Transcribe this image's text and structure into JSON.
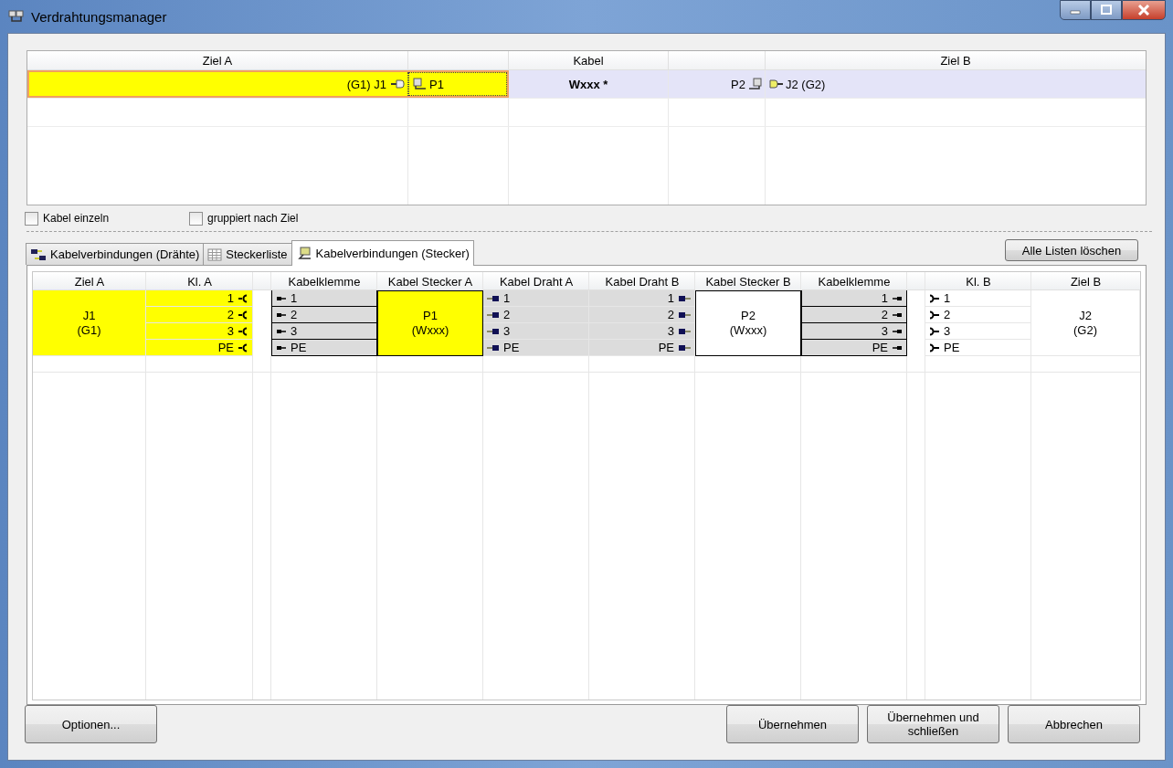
{
  "window": {
    "title": "Verdrahtungsmanager"
  },
  "cable_grid": {
    "columns": [
      "Ziel A",
      "Kabel",
      "Ziel B"
    ],
    "rows": [
      {
        "target_a": "(G1) J1",
        "plug_a": "P1",
        "cable": "Wxxx *",
        "plug_b": "P2",
        "target_b": "J2 (G2)",
        "selected": true,
        "highlighted": true
      }
    ]
  },
  "options": [
    {
      "label": "Kabel einzeln",
      "checked": false
    },
    {
      "label": "gruppiert nach Ziel",
      "checked": false
    }
  ],
  "tabs": [
    {
      "label": "Kabelverbindungen (Drähte)",
      "selected": false
    },
    {
      "label": "Steckerliste",
      "selected": false
    },
    {
      "label": "Kabelverbindungen (Stecker)",
      "selected": true
    }
  ],
  "clear_button": "Alle Listen löschen",
  "connection_table": {
    "columns": [
      "Ziel A",
      "Kl. A",
      "Kabelklemme",
      "Kabel Stecker A",
      "Kabel Draht A",
      "Kabel Draht B",
      "Kabel Stecker B",
      "Kabelklemme",
      "Kl. B",
      "Ziel B"
    ],
    "side_a": {
      "target": "J1",
      "group": "(G1)",
      "highlighted": true,
      "plug": "P1",
      "cable": "(Wxxx)",
      "plug_highlighted": true
    },
    "side_b": {
      "target": "J2",
      "group": "(G2)",
      "highlighted": false,
      "plug": "P2",
      "cable": "(Wxxx)",
      "plug_highlighted": false
    },
    "rows": [
      {
        "kl_a": "1",
        "klemme_a": "1",
        "draht_a": "1",
        "draht_b": "1",
        "klemme_b": "1",
        "kl_b": "1"
      },
      {
        "kl_a": "2",
        "klemme_a": "2",
        "draht_a": "2",
        "draht_b": "2",
        "klemme_b": "2",
        "kl_b": "2"
      },
      {
        "kl_a": "3",
        "klemme_a": "3",
        "draht_a": "3",
        "draht_b": "3",
        "klemme_b": "3",
        "kl_b": "3"
      },
      {
        "kl_a": "PE",
        "klemme_a": "PE",
        "draht_a": "PE",
        "draht_b": "PE",
        "klemme_b": "PE",
        "kl_b": "PE"
      }
    ]
  },
  "buttons": {
    "left": [
      "Optionen..."
    ],
    "right": [
      "Übernehmen",
      "Übernehmen und schließen",
      "Abbrechen"
    ]
  }
}
